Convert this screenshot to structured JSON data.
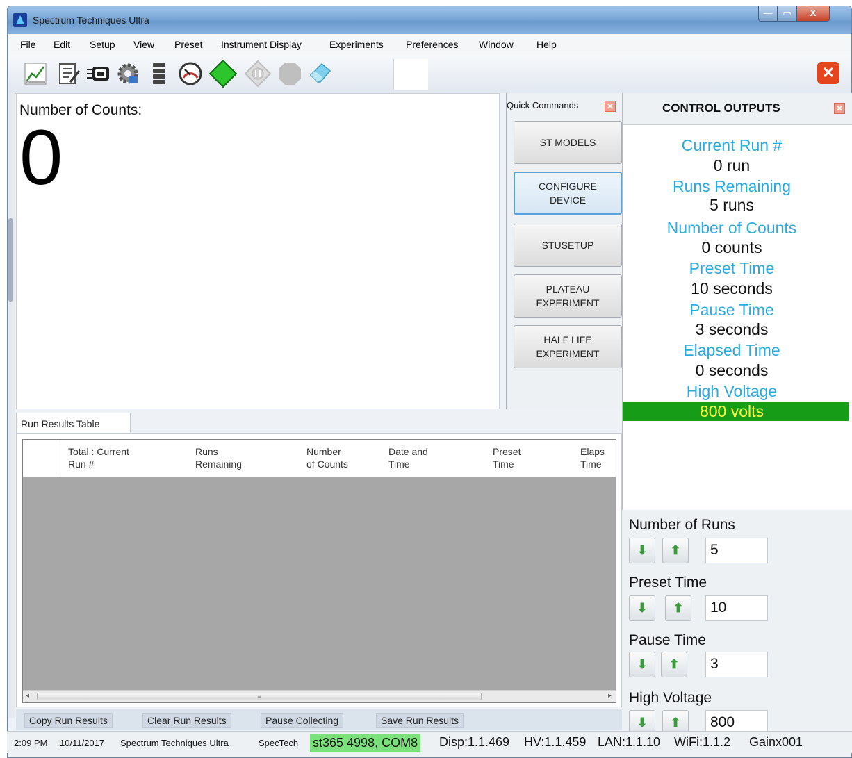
{
  "window": {
    "title": "Spectrum Techniques Ultra",
    "minimize": "—",
    "maximize": "▭",
    "close": "X"
  },
  "menu": [
    "File",
    "Edit",
    "Setup",
    "View",
    "Preset",
    "Instrument Display",
    "Experiments",
    "Preferences",
    "Window",
    "Help"
  ],
  "toolbar": {
    "icons": [
      "chart-icon",
      "edit-form-icon",
      "device-icon",
      "settings-gear-icon",
      "list-icon",
      "gauge-icon",
      "start-diamond-icon",
      "pause-icon",
      "stop-icon",
      "eraser-icon"
    ],
    "close_label": "✕"
  },
  "counts": {
    "label": "Number of Counts:",
    "value": "0"
  },
  "quick_commands": {
    "title": "Quick Commands",
    "buttons": [
      "ST MODELS",
      "CONFIGURE DEVICE",
      "STUSETUP",
      "PLATEAU EXPERIMENT",
      "HALF LIFE EXPERIMENT"
    ]
  },
  "control_outputs": {
    "title": "CONTROL OUTPUTS",
    "current_run_label": "Current Run #",
    "current_run_value": "0 run",
    "runs_remaining_label": "Runs Remaining",
    "runs_remaining_value": "5 runs",
    "counts_label": "Number  of Counts",
    "counts_value": "0 counts",
    "preset_time_label": "Preset Time",
    "preset_time_value": "10 seconds",
    "pause_time_label": "Pause Time",
    "pause_time_value": "3 seconds",
    "elapsed_time_label": "Elapsed Time",
    "elapsed_time_value": "0 seconds",
    "high_voltage_label": "High Voltage",
    "high_voltage_value": "800 volts"
  },
  "settings": {
    "runs_label": "Number of Runs",
    "runs_value": "5",
    "preset_label": "Preset Time",
    "preset_value": "10",
    "pause_label": "Pause Time",
    "pause_value": "3",
    "hv_label": "High Voltage",
    "hv_value": "800",
    "down_arrow": "⬇",
    "up_arrow": "⬆"
  },
  "run_results": {
    "tab": "Run Results Table",
    "columns": [
      "Total : Current\nRun #",
      "Runs\nRemaining",
      "Number\nof Counts",
      "Date and\nTime",
      "Preset\nTime",
      "Elaps\nTime"
    ]
  },
  "actions": [
    "Copy Run Results",
    "Clear Run Results",
    "Pause Collecting",
    "Save Run Results"
  ],
  "status": {
    "time": "2:09 PM",
    "date": "10/11/2017",
    "app": "Spectrum Techniques Ultra",
    "vendor": "SpecTech",
    "device": "st365 4998, COM8",
    "disp": "Disp:1.1.469",
    "hv": "HV:1.1.459",
    "lan": "LAN:1.1.10",
    "wifi": "WiFi:1.1.2",
    "gain": "Gainx001"
  },
  "colors": {
    "label_blue": "#2ba9e1",
    "hv_green": "#179c17",
    "hv_yellow": "#ffff38",
    "device_green": "#7be27b"
  }
}
